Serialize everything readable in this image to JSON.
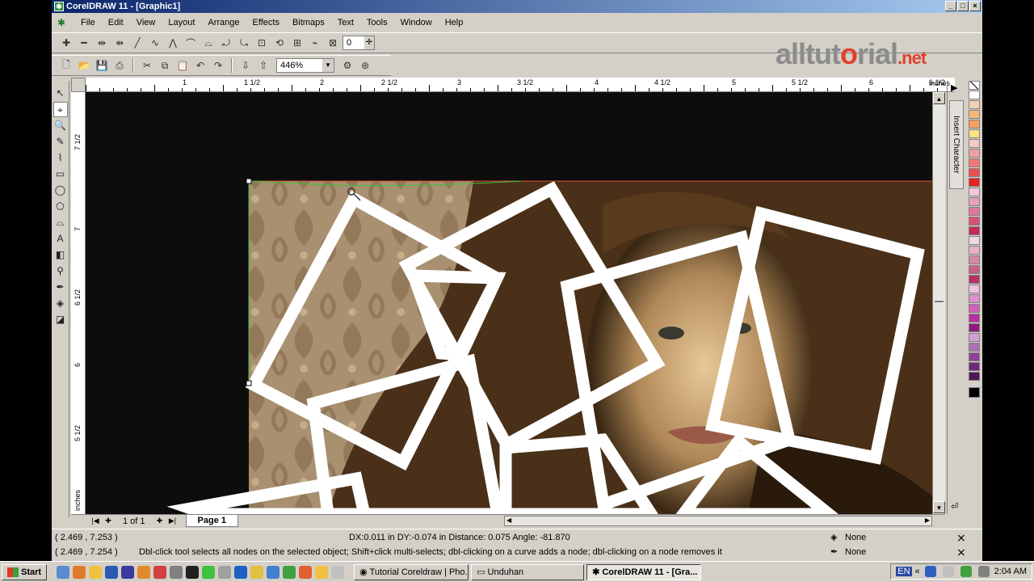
{
  "window": {
    "title": "CorelDRAW 11 - [Graphic1]"
  },
  "menu": [
    "File",
    "Edit",
    "View",
    "Layout",
    "Arrange",
    "Effects",
    "Bitmaps",
    "Text",
    "Tools",
    "Window",
    "Help"
  ],
  "property_bar": {
    "node_angle_value": "0"
  },
  "standard_bar": {
    "zoom_value": "446%"
  },
  "logo": {
    "main": "alltut",
    "accent": "o",
    "rest": "rial",
    "tld": ".net"
  },
  "ruler_h": {
    "unit": "inches",
    "labels": [
      "1",
      "1 1/2",
      "2",
      "2 1/2",
      "3",
      "3 1/2",
      "4",
      "4 1/2",
      "5",
      "5 1/2",
      "6",
      "6 1/2"
    ]
  },
  "ruler_v": {
    "unit": "inches",
    "labels": [
      "7 1/2",
      "7",
      "6 1/2",
      "6",
      "5 1/2"
    ]
  },
  "docker": {
    "tab_label": "Insert Character"
  },
  "palette": {
    "colors": [
      "#ffffff",
      "#f4d0b0",
      "#f8b878",
      "#f4a060",
      "#ffe080",
      "#f8c8c8",
      "#f0a0a0",
      "#f07878",
      "#e85050",
      "#e82020",
      "#f0c8d8",
      "#e8a0b8",
      "#e07898",
      "#d85078",
      "#c82858",
      "#f0d8e0",
      "#e8b0c8",
      "#d888a8",
      "#c86088",
      "#b83068",
      "#f0c0e8",
      "#e090d0",
      "#d060b8",
      "#b830a0",
      "#901880",
      "#d0a0d0",
      "#b070b8",
      "#904098",
      "#702878",
      "#501858",
      "#000000"
    ]
  },
  "page_nav": {
    "position": "1 of 1",
    "page_tab": "Page 1"
  },
  "status": {
    "cursor_pos_1": "( 2.469 , 7.253 )",
    "cursor_pos_2": "( 2.469 , 7.254 )",
    "measure": "DX:0.011 in DY:-0.074 in Distance: 0.075 Angle: -81.870",
    "hint": "Dbl-click tool selects all nodes on the selected object; Shift+click multi-selects; dbl-clicking on a curve adds a node; dbl-clicking on a node removes it",
    "fill": "None",
    "outline": "None"
  },
  "taskbar": {
    "start": "Start",
    "tasks": [
      "Tutorial Coreldraw | Pho...",
      "Unduhan",
      "CorelDRAW 11 - [Gra..."
    ],
    "lang": "EN",
    "clock": "2:04 AM"
  }
}
